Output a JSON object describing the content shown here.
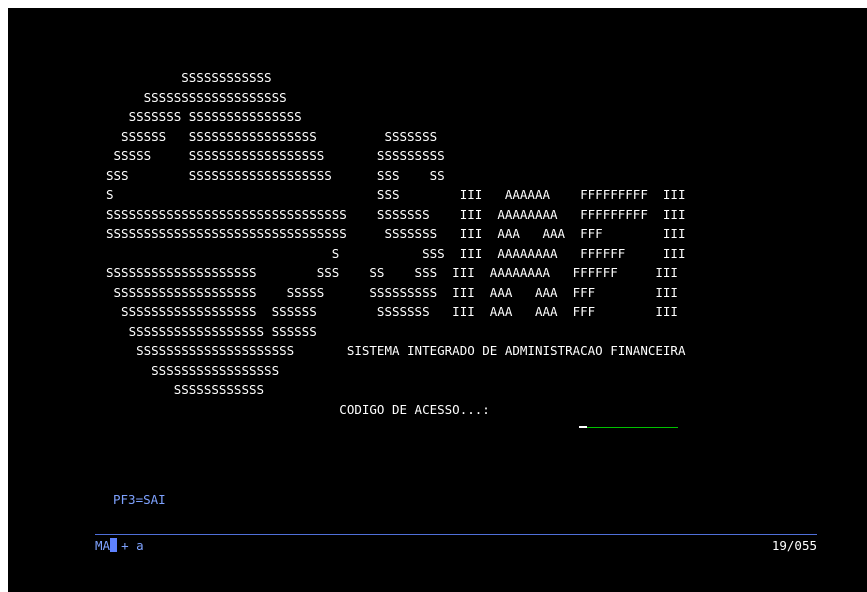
{
  "screen": {
    "lines": [
      "          SSSSSSSSSSSS",
      "     SSSSSSSSSSSSSSSSSSS",
      "   SSSSSSS SSSSSSSSSSSSSSS",
      "  SSSSSS   SSSSSSSSSSSSSSSSS         SSSSSSS",
      " SSSSS     SSSSSSSSSSSSSSSSSS       SSSSSSSSS",
      "SSS        SSSSSSSSSSSSSSSSSSS      SSS    SS",
      "S                                   SSS        III   AAAAAA    FFFFFFFFF  III",
      "SSSSSSSSSSSSSSSSSSSSSSSSSSSSSSSS    SSSSSSS    III  AAAAAAAA   FFFFFFFFF  III",
      "SSSSSSSSSSSSSSSSSSSSSSSSSSSSSSSS     SSSSSSS   III  AAA   AAA  FFF        III",
      "                              S           SSS  III  AAAAAAAA   FFFFFF     III",
      "SSSSSSSSSSSSSSSSSSSS        SSS    SS    SSS  III  AAAAAAAA   FFFFFF     III",
      " SSSSSSSSSSSSSSSSSSS    SSSSS      SSSSSSSSS  III  AAA   AAA  FFF        III",
      "  SSSSSSSSSSSSSSSSSS  SSSSSS        SSSSSSS   III  AAA   AAA  FFF        III",
      "   SSSSSSSSSSSSSSSSSS SSSSSS",
      "    SSSSSSSSSSSSSSSSSSSSS       SISTEMA INTEGRADO DE ADMINISTRACAO FINANCEIRA",
      "      SSSSSSSSSSSSSSSSS",
      "         SSSSSSSSSSSS",
      "                               CODIGO DE ACESSO...: "
    ],
    "code_field_value": "",
    "pf_keys": "PF3=SAI",
    "status": {
      "mode_indicator": "MA",
      "marker": "+",
      "session": "a",
      "cursor_position": "19/055"
    },
    "colors": {
      "background": "#000000",
      "text": "#ffffff",
      "field_underline": "#00c000",
      "status_text": "#7ea2ff",
      "status_line": "#4f6fd9"
    }
  }
}
